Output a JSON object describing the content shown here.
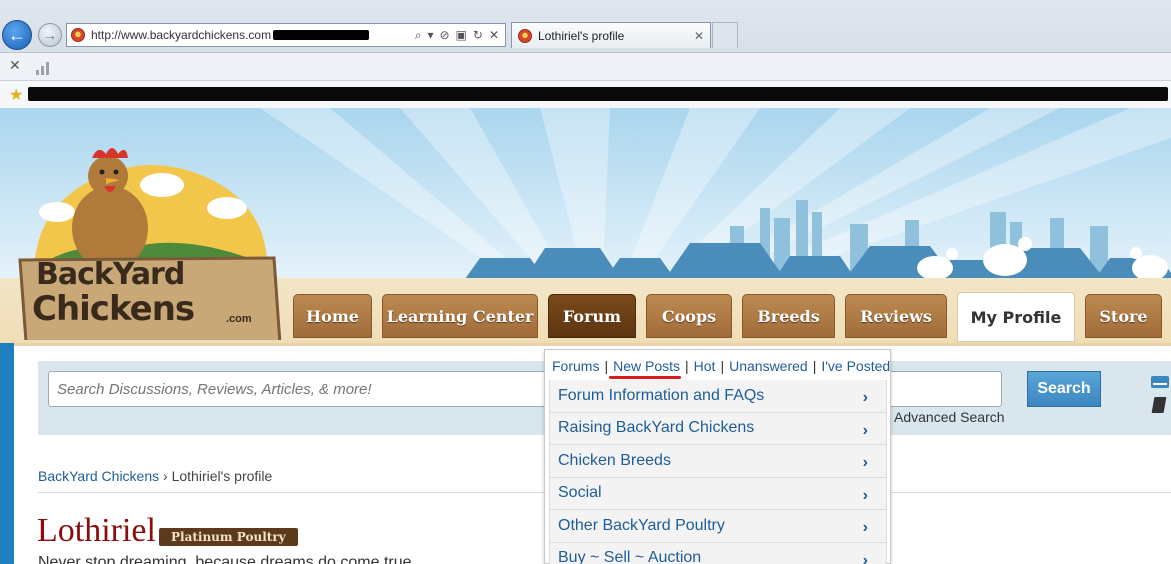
{
  "browser": {
    "url": "http://www.backyardchickens.com",
    "tab_title": "Lothiriel's profile",
    "tab_close": "✕",
    "stop_label": "✕"
  },
  "site": {
    "logo": {
      "line1": "BackYard",
      "line2": "Chickens",
      "dotcom": ".com"
    },
    "nav": [
      {
        "label": "Home"
      },
      {
        "label": "Learning Center"
      },
      {
        "label": "Forum"
      },
      {
        "label": "Coops"
      },
      {
        "label": "Breeds"
      },
      {
        "label": "Reviews"
      },
      {
        "label": "My Profile"
      },
      {
        "label": "Store"
      }
    ],
    "search": {
      "placeholder": "Search Discussions, Reviews, Articles, & more!",
      "button_label": "Search",
      "advanced_label": "Advanced Search"
    },
    "breadcrumb": {
      "root": "BackYard Chickens",
      "separator": "›",
      "current": "Lothiriel's profile"
    },
    "profile": {
      "name": "Lothiriel",
      "rank": "Platinum Poultry",
      "tagline": "Never stop dreaming, because dreams do come true."
    },
    "forum_menu": {
      "links": [
        "Forums",
        "New Posts",
        "Hot",
        "Unanswered",
        "I've Posted"
      ],
      "separator": "|",
      "items": [
        "Forum Information and FAQs",
        "Raising BackYard Chickens",
        "Chicken Breeds",
        "Social",
        "Other BackYard Poultry",
        "Buy ~ Sell ~ Auction"
      ],
      "chevron": "›"
    }
  },
  "colors": {
    "tab_brown": "#a06c3a",
    "tab_dark": "#5e3510",
    "link_blue": "#1f5d99",
    "profile_red": "#8b0d0d",
    "highlight_red": "#d81c1c"
  }
}
